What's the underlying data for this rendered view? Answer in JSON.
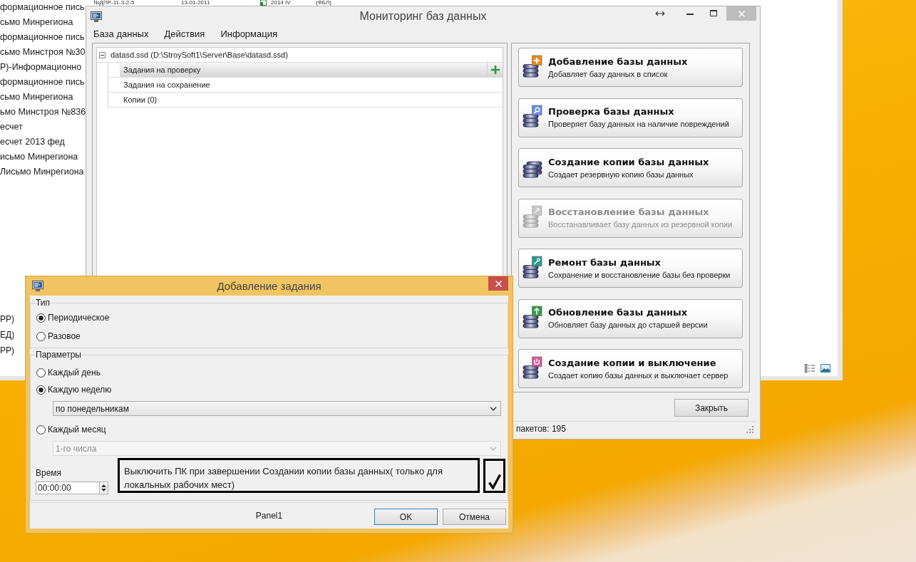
{
  "background_window": {
    "top_row": [
      "№ДПР-11-3-2-5",
      "13-01-2011",
      "2014 IV",
      "(ФБЛ)"
    ],
    "list_items": [
      "формационное пись",
      "сьмо Минрегиона",
      "формационное пись",
      "сьмо Минстроя №30",
      "Р)-Информационно",
      "формационное пись",
      "сьмо Минрегиона",
      "ьмо Минстроя №836",
      "есчет",
      "есчет 2013 фед",
      "исьмо Минрегиона",
      "Лисьмо Минрегиона"
    ],
    "lower_items": [
      "РР)",
      "ЕД)",
      "РР)"
    ]
  },
  "main_window": {
    "title": "Мониторинг баз данных",
    "menu": [
      "База данных",
      "Действия",
      "Информация"
    ],
    "tree": {
      "label": "datasd.ssd (D:\\StroySoft1\\Server\\Base\\datasd.ssd)",
      "expanded": true,
      "children": [
        {
          "label": "Задания на проверку",
          "selected": true
        },
        {
          "label": "Задания на сохранение",
          "selected": false
        },
        {
          "label": "Копии (0)",
          "selected": false
        }
      ]
    },
    "actions": [
      {
        "title": "Добавление базы данных",
        "description": "Добавляет базу данных в список",
        "disabled": false
      },
      {
        "title": "Проверка базы данных",
        "description": "Проверяет базу данных на наличие повреждений",
        "disabled": false
      },
      {
        "title": "Создание копии базы данных",
        "description": "Создает резервную копию базы данных",
        "disabled": false
      },
      {
        "title": "Восстановление базы данных",
        "description": "Восстанавливает базу данных из резервной копии",
        "disabled": true
      },
      {
        "title": "Ремонт базы данных",
        "description": "Сохранение и восстановление базы без проверки",
        "disabled": false
      },
      {
        "title": "Обновление базы данных",
        "description": "Обновляет базу данных до старшей версии",
        "disabled": false
      },
      {
        "title": "Создание копии и выключение",
        "description": "Создает копию базы данных и выключает сервер",
        "disabled": false
      }
    ],
    "close_button": "Закрыть",
    "status_bar": "пакетов: 195"
  },
  "dialog": {
    "title": "Добавление задания",
    "type_group": {
      "legend": "Тип",
      "options": [
        {
          "label": "Периодическое",
          "selected": true
        },
        {
          "label": "Разовое",
          "selected": false
        }
      ]
    },
    "parameters_group": {
      "legend": "Параметры",
      "options": [
        {
          "label": "Каждый день",
          "selected": false
        },
        {
          "label": "Каждую неделю",
          "selected": true,
          "dropdown": {
            "value": "по понедельникам",
            "disabled": false
          }
        },
        {
          "label": "Каждый месяц",
          "selected": false,
          "dropdown": {
            "value": "1-го числа",
            "disabled": true
          }
        }
      ]
    },
    "time": {
      "label": "Время",
      "value": "00:00:00"
    },
    "shutdown_option": {
      "label": "Выключить ПК при завершении Создании копии базы данных( только для локальных рабочих мест)",
      "checked": true
    },
    "footer_label": "Panel1",
    "buttons": [
      {
        "label": "OK",
        "focused": true
      },
      {
        "label": "Отмена",
        "focused": false
      }
    ]
  }
}
